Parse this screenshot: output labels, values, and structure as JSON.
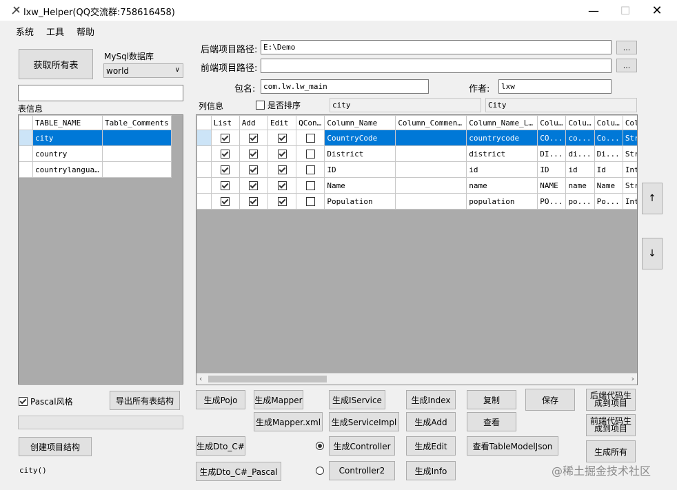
{
  "window": {
    "title": "lxw_Helper(QQ交流群:758616458)"
  },
  "menu": [
    "系统",
    "工具",
    "帮助"
  ],
  "left": {
    "get_all_tables": "获取所有表",
    "db_label": "MySql数据库",
    "db_selected": "world",
    "search_value": "",
    "table_info_label": "表信息",
    "table_headers": [
      "TABLE_NAME",
      "Table_Comments"
    ],
    "tables": [
      {
        "name": "city",
        "comment": ""
      },
      {
        "name": "country",
        "comment": ""
      },
      {
        "name": "countrylanguage",
        "comment": ""
      }
    ],
    "pascal_label": "Pascal风格",
    "pascal_checked": true,
    "export_button": "导出所有表结构",
    "create_project_button": "创建项目结构",
    "status_text": "city()"
  },
  "form": {
    "backend_label": "后端项目路径:",
    "backend_value": "E:\\Demo",
    "frontend_label": "前端项目路径:",
    "frontend_value": "",
    "browse": "...",
    "package_label": "包名:",
    "package_value": "com.lw.lw_main",
    "author_label": "作者:",
    "author_value": "lxw",
    "columns_label": "列信息",
    "sort_label": "是否排序",
    "table_name": "city",
    "class_name": "City"
  },
  "columns_grid": {
    "headers": [
      "List",
      "Add",
      "Edit",
      "QCond:",
      "Column_Name",
      "Column_Comments",
      "Column_Name_Lower",
      "Column_",
      "Column_",
      "Column_",
      "Column_"
    ],
    "rows": [
      {
        "list": true,
        "add": true,
        "edit": true,
        "qcond": false,
        "name": "CountryCode",
        "comment": "",
        "lower": "countrycode",
        "c1": "CO...",
        "c2": "co...",
        "c3": "Co...",
        "c4": "String"
      },
      {
        "list": true,
        "add": true,
        "edit": true,
        "qcond": false,
        "name": "District",
        "comment": "",
        "lower": "district",
        "c1": "DI...",
        "c2": "di...",
        "c3": "Di...",
        "c4": "String"
      },
      {
        "list": true,
        "add": true,
        "edit": true,
        "qcond": false,
        "name": "ID",
        "comment": "",
        "lower": "id",
        "c1": "ID",
        "c2": "id",
        "c3": "Id",
        "c4": "Integer"
      },
      {
        "list": true,
        "add": true,
        "edit": true,
        "qcond": false,
        "name": "Name",
        "comment": "",
        "lower": "name",
        "c1": "NAME",
        "c2": "name",
        "c3": "Name",
        "c4": "String"
      },
      {
        "list": true,
        "add": true,
        "edit": true,
        "qcond": false,
        "name": "Population",
        "comment": "",
        "lower": "population",
        "c1": "PO...",
        "c2": "po...",
        "c3": "Po...",
        "c4": "Integer"
      }
    ]
  },
  "buttons": {
    "pojo": "生成Pojo",
    "mapper": "生成Mapper",
    "iservice": "生成IService",
    "index": "生成Index",
    "copy": "复制",
    "save": "保存",
    "backend_gen_1": "后端代码生",
    "backend_gen_2": "成到项目",
    "mapper_xml": "生成Mapper.xml",
    "service_impl": "生成ServiceImpl",
    "add": "生成Add",
    "view": "查看",
    "frontend_gen_1": "前端代码生",
    "frontend_gen_2": "成到项目",
    "dto": "生成Dto_C#",
    "controller": "生成Controller",
    "edit": "生成Edit",
    "view_json": "查看TableModelJson",
    "gen_all": "生成所有",
    "dto_pascal": "生成Dto_C#_Pascal",
    "controller2": "Controller2",
    "info": "生成Info",
    "up": "↑",
    "down": "↓"
  },
  "radio": {
    "controller_selected": true
  },
  "watermark": "@稀土掘金技术社区"
}
